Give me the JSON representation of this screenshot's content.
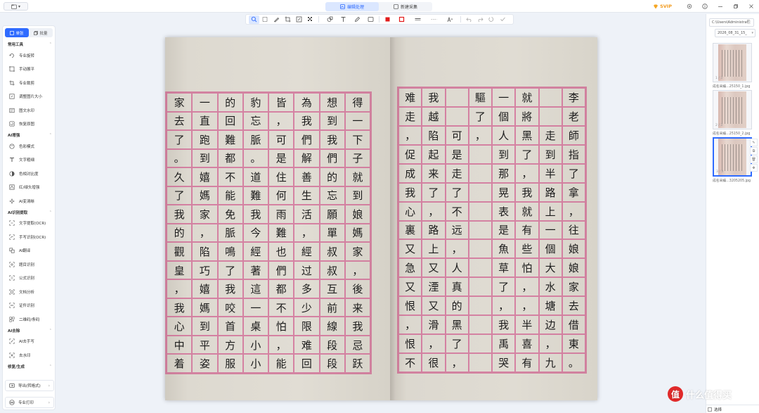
{
  "topbar": {
    "app_menu_label": "▾",
    "mode_tabs": [
      {
        "label": "编辑处理",
        "active": true
      },
      {
        "label": "新建采集",
        "active": false
      }
    ],
    "svip_label": "SVIP",
    "accent_color": "#2f6bff"
  },
  "sidebar": {
    "tabs": [
      {
        "label": "单张",
        "active": true
      },
      {
        "label": "批量",
        "active": false
      }
    ],
    "sections": [
      {
        "title": "常用工具",
        "items": [
          {
            "label": "专业旋转",
            "icon": "rotate-icon"
          },
          {
            "label": "手动展平",
            "icon": "flatten-icon"
          },
          {
            "label": "专业裁剪",
            "icon": "crop-icon"
          },
          {
            "label": "调整图片大小",
            "icon": "resize-icon"
          },
          {
            "label": "图文水印",
            "icon": "watermark-icon"
          },
          {
            "label": "恢复原图",
            "icon": "restore-icon"
          }
        ]
      },
      {
        "title": "AI增强",
        "items": [
          {
            "label": "色彩模式",
            "icon": "palette-icon"
          },
          {
            "label": "文字粗细",
            "icon": "text-weight-icon"
          },
          {
            "label": "色相对比度",
            "icon": "contrast-icon"
          },
          {
            "label": "红/绿头增强",
            "icon": "enhance-icon"
          },
          {
            "label": "AI变清晰",
            "icon": "sharpen-icon"
          }
        ]
      },
      {
        "title": "AI识别提取",
        "items": [
          {
            "label": "文字提取(OCR)",
            "icon": "ocr-icon"
          },
          {
            "label": "手写识别(OCR)",
            "icon": "handwriting-icon"
          },
          {
            "label": "AI翻译",
            "icon": "translate-icon"
          },
          {
            "label": "题目识别",
            "icon": "question-icon"
          },
          {
            "label": "公式识别",
            "icon": "formula-icon"
          },
          {
            "label": "文档分析",
            "icon": "document-icon"
          },
          {
            "label": "证件识别",
            "icon": "id-card-icon"
          },
          {
            "label": "二维码/条码",
            "icon": "qr-icon"
          }
        ]
      },
      {
        "title": "AI去除",
        "items": [
          {
            "label": "AI去手写",
            "icon": "erase-icon"
          },
          {
            "label": "去水印",
            "icon": "remove-watermark-icon"
          }
        ]
      },
      {
        "title": "修复/生成",
        "items": []
      }
    ],
    "bottom": [
      {
        "label": "导出(转格式)",
        "icon": "export-icon"
      },
      {
        "label": "专业打印",
        "icon": "print-icon"
      }
    ]
  },
  "page_text": {
    "left_grid": [
      [
        "家",
        "一",
        "的",
        "豹",
        "皆",
        "為",
        "想",
        "得"
      ],
      [
        "去",
        "直",
        "回",
        "忘",
        "，",
        "我",
        "到",
        "一"
      ],
      [
        "了",
        "跑",
        "難",
        "脈",
        "可",
        "們",
        "我",
        "下"
      ],
      [
        "。",
        "到",
        "都",
        "。",
        "是",
        "解",
        "們",
        "子"
      ],
      [
        "久",
        "嬉",
        "不",
        "道",
        "住",
        "善",
        "的",
        "就"
      ],
      [
        "了",
        "媽",
        "能",
        "難",
        "何",
        "生",
        "忘",
        "到"
      ],
      [
        "我",
        "家",
        "免",
        "我",
        "雨",
        "活",
        "願",
        "娘"
      ],
      [
        "的",
        "，",
        "脈",
        "今",
        "難",
        "，",
        "單",
        "媽"
      ],
      [
        "觀",
        "陷",
        "鳴",
        "經",
        "也",
        "經",
        "叔",
        "家"
      ],
      [
        "皇",
        "巧",
        "了",
        "著",
        "們",
        "过",
        "叔",
        "，"
      ],
      [
        "，",
        "嬉",
        "我",
        "這",
        "都",
        "多",
        "互",
        "後"
      ],
      [
        "我",
        "媽",
        "咬",
        "一",
        "不",
        "少",
        "前",
        "来"
      ],
      [
        "心",
        "到",
        "首",
        "桌",
        "怕",
        "限",
        "線",
        "我"
      ],
      [
        "中",
        "平",
        "方",
        "小",
        "，",
        "难",
        "段",
        "忌"
      ],
      [
        "着",
        "姿",
        "服",
        "小",
        "能",
        "回",
        "段",
        "跃"
      ]
    ],
    "right_grid": [
      [
        "难",
        "我",
        "",
        "驅",
        "一",
        "就",
        "",
        "李"
      ],
      [
        "走",
        "越",
        "",
        "了",
        "個",
        "將",
        "",
        "老"
      ],
      [
        "，",
        "陷",
        "可",
        "，",
        "人",
        "黑",
        "走",
        "師"
      ],
      [
        "促",
        "起",
        "是",
        "",
        "到",
        "了",
        "到",
        "指"
      ],
      [
        "成",
        "来",
        "走",
        "",
        "那",
        "，",
        "半",
        "了"
      ],
      [
        "我",
        "了",
        "了",
        "",
        "晃",
        "我",
        "路",
        "拿"
      ],
      [
        "心",
        "，",
        "不",
        "",
        "表",
        "就",
        "上",
        "，"
      ],
      [
        "裏",
        "路",
        "远",
        "",
        "是",
        "有",
        "一",
        "往"
      ],
      [
        "又",
        "上",
        "，",
        "",
        "魚",
        "些",
        "個",
        "娘"
      ],
      [
        "急",
        "又",
        "人",
        "",
        "草",
        "怕",
        "大",
        "娘"
      ],
      [
        "又",
        "湮",
        "真",
        "",
        "了",
        "，",
        "水",
        "家"
      ],
      [
        "恨",
        "又",
        "的",
        "",
        "，",
        "，",
        "塘",
        "去"
      ],
      [
        "，",
        "滑",
        "黑",
        "",
        "我",
        "半",
        "边",
        "借"
      ],
      [
        "恨",
        "，",
        "了",
        "",
        "禹",
        "喜",
        "，",
        "東"
      ],
      [
        "不",
        "很",
        "，",
        "",
        "哭",
        "有",
        "九",
        "。"
      ]
    ]
  },
  "right_panel": {
    "path": "C:\\Users\\Administrat",
    "folder": "2026_08_31_15_",
    "thumbnails": [
      {
        "num": "1 / 3",
        "label": "成名采编...25150_1.jpg",
        "selected": false
      },
      {
        "num": "2 / 3",
        "label": "成名采编...25150_2.jpg",
        "selected": false
      },
      {
        "num": "3 / 3",
        "label": "成名采编...3205205.jpg",
        "selected": true
      }
    ],
    "select_label": "选择"
  },
  "watermark": {
    "logo": "值",
    "text": "什么值得买"
  }
}
